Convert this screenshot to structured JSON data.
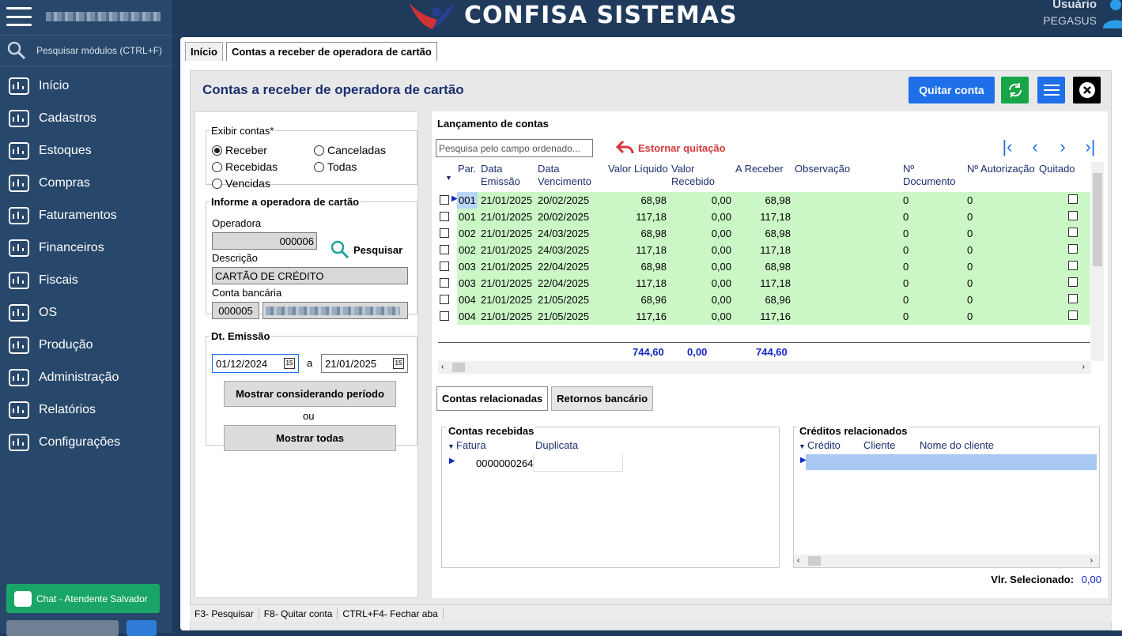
{
  "sidebar": {
    "search_placeholder": "Pesquisar módulos (CTRL+F)",
    "items": [
      {
        "label": "Início",
        "icon": "dashboard-icon"
      },
      {
        "label": "Cadastros",
        "icon": "folder-icon"
      },
      {
        "label": "Estoques",
        "icon": "stock-icon"
      },
      {
        "label": "Compras",
        "icon": "basket-icon"
      },
      {
        "label": "Faturamentos",
        "icon": "invoice-icon"
      },
      {
        "label": "Financeiros",
        "icon": "dollar-icon"
      },
      {
        "label": "Fiscais",
        "icon": "document-icon"
      },
      {
        "label": "OS",
        "icon": "hand-gear-icon"
      },
      {
        "label": "Produção",
        "icon": "factory-icon"
      },
      {
        "label": "Administração",
        "icon": "monitor-gear-icon"
      },
      {
        "label": "Relatórios",
        "icon": "report-icon"
      },
      {
        "label": "Configurações",
        "icon": "gear-icon"
      }
    ],
    "chat_label": "Chat - Atendente Salvador"
  },
  "header": {
    "brand": "CONFISA SISTEMAS",
    "user_label": "Usuário",
    "user_name": "PEGASUS"
  },
  "tabs": [
    "Início",
    "Contas a receber de operadora de cartão"
  ],
  "page": {
    "title": "Contas a receber de operadora de cartão",
    "quitar_label": "Quitar conta",
    "accent": "#1e6fe8"
  },
  "filter": {
    "exibir_legend": "Exibir contas*",
    "options": [
      "Receber",
      "Canceladas",
      "Recebidas",
      "Todas",
      "Vencidas"
    ],
    "selected": "Receber",
    "operadora_legend": "Informe a operadora de cartão",
    "operadora_label": "Operadora",
    "operadora_value": "000006",
    "pesquisar_label": "Pesquisar",
    "descricao_label": "Descrição",
    "descricao_value": "CARTÃO DE CRÉDITO",
    "conta_label": "Conta bancária",
    "conta_value": "000005",
    "emissao_legend": "Dt. Emissão",
    "date_from": "01/12/2024",
    "date_sep": "a",
    "date_to": "21/01/2025",
    "btn_periodo": "Mostrar considerando período",
    "ou": "ou",
    "btn_todas": "Mostrar todas"
  },
  "lancamentos": {
    "title": "Lançamento de contas",
    "search_placeholder": "Pesquisa pelo campo ordenado...",
    "estornar": "Estornar quitação",
    "columns": [
      "Par.",
      "Data Emissão",
      "Data Vencimento",
      "Valor Líquido",
      "Valor Recebido",
      "A Receber",
      "Observação",
      "Nº Documento",
      "Nº Autorização",
      "Quitado"
    ],
    "rows": [
      [
        "001",
        "21/01/2025",
        "20/02/2025",
        "68,98",
        "0,00",
        "68,98",
        "",
        "0",
        "0"
      ],
      [
        "001",
        "21/01/2025",
        "20/02/2025",
        "117,18",
        "0,00",
        "117,18",
        "",
        "0",
        "0"
      ],
      [
        "002",
        "21/01/2025",
        "24/03/2025",
        "68,98",
        "0,00",
        "68,98",
        "",
        "0",
        "0"
      ],
      [
        "002",
        "21/01/2025",
        "24/03/2025",
        "117,18",
        "0,00",
        "117,18",
        "",
        "0",
        "0"
      ],
      [
        "003",
        "21/01/2025",
        "22/04/2025",
        "68,98",
        "0,00",
        "68,98",
        "",
        "0",
        "0"
      ],
      [
        "003",
        "21/01/2025",
        "22/04/2025",
        "117,18",
        "0,00",
        "117,18",
        "",
        "0",
        "0"
      ],
      [
        "004",
        "21/01/2025",
        "21/05/2025",
        "68,96",
        "0,00",
        "68,96",
        "",
        "0",
        "0"
      ],
      [
        "004",
        "21/01/2025",
        "21/05/2025",
        "117,16",
        "0,00",
        "117,16",
        "",
        "0",
        "0"
      ]
    ],
    "totals": {
      "liquido": "744,60",
      "recebido": "0,00",
      "receber": "744,60"
    }
  },
  "bottom": {
    "tabs": [
      "Contas relacionadas",
      "Retornos bancário"
    ],
    "recebidas_title": "Contas recebidas",
    "recebidas_cols": [
      "Fatura",
      "Duplicata"
    ],
    "recebidas_row": [
      "0000000264",
      ""
    ],
    "creditos_title": "Créditos relacionados",
    "creditos_cols": [
      "Crédito",
      "Cliente",
      "Nome do cliente"
    ],
    "vlr_label": "Vlr. Selecionado:",
    "vlr_value": "0,00"
  },
  "status": [
    "F3- Pesquisar",
    "F8- Quitar conta",
    "CTRL+F4- Fechar aba"
  ]
}
